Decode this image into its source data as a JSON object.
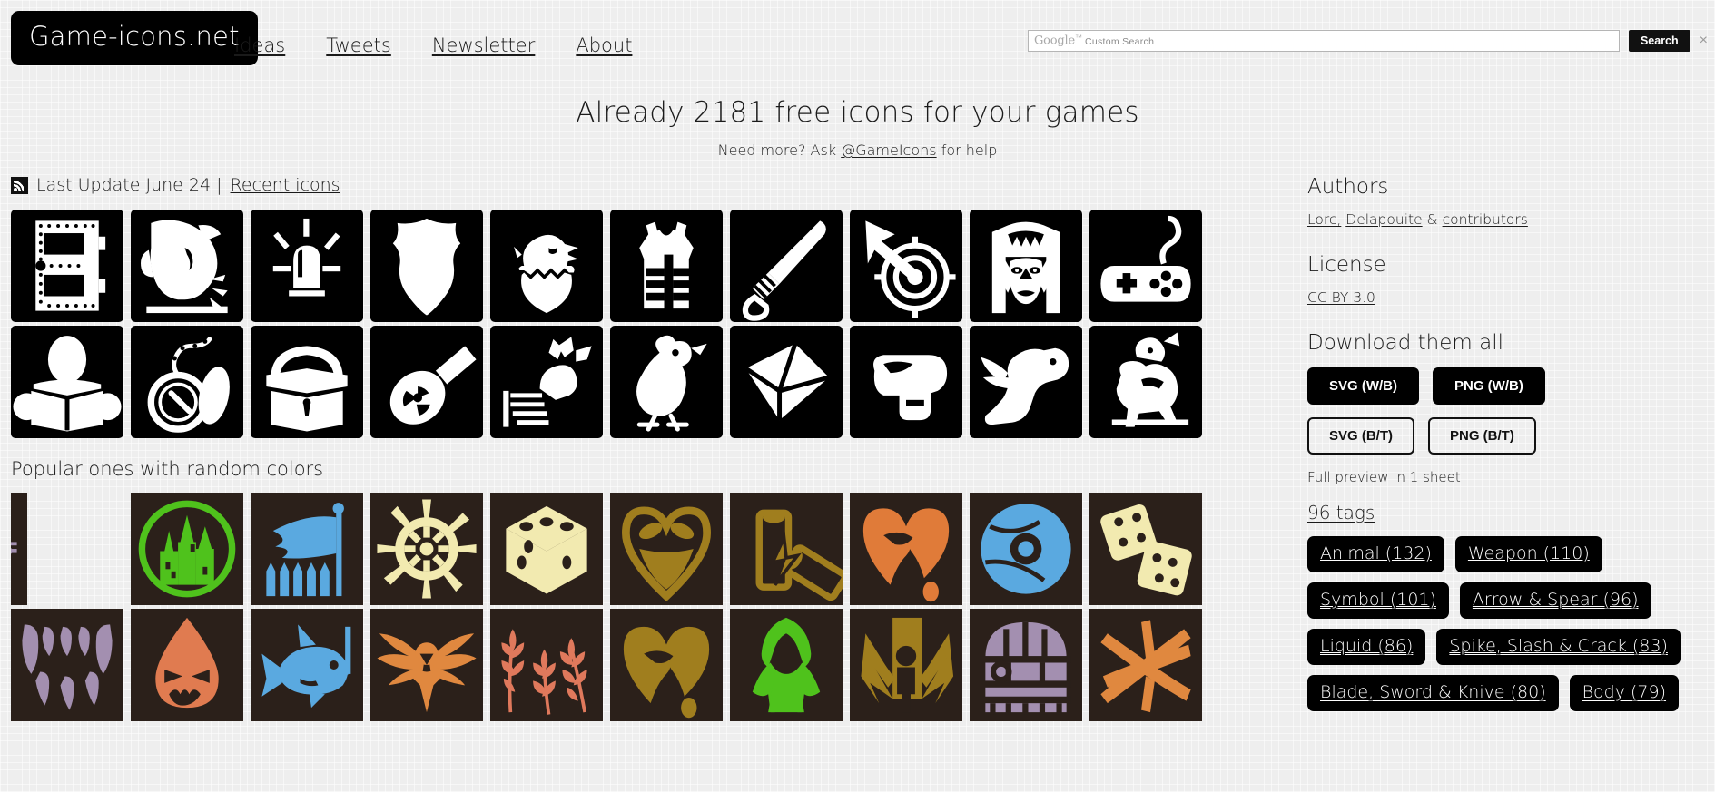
{
  "header": {
    "logo": "Game-icons.net",
    "nav": [
      {
        "label": "Ideas"
      },
      {
        "label": "Tweets"
      },
      {
        "label": "Newsletter"
      },
      {
        "label": "About"
      }
    ],
    "search": {
      "google_word": "Google",
      "tm": "™",
      "placeholder_suffix": "Custom Search",
      "value": "",
      "button_label": "Search",
      "close_icon": "×"
    }
  },
  "hero": {
    "title": "Already 2181 free icons for your games",
    "sub_prefix": "Need more? Ask ",
    "sub_link": "@GameIcons",
    "sub_suffix": " for help"
  },
  "update": {
    "icon": "rss-icon",
    "text": "Last Update June 24 |",
    "link": "Recent icons"
  },
  "sections": {
    "popular_title": "Popular ones with random colors"
  },
  "bw_icons": [
    {
      "name": "metal-door-icon"
    },
    {
      "name": "boar-snout-icon"
    },
    {
      "name": "siren-light-icon"
    },
    {
      "name": "police-badge-icon"
    },
    {
      "name": "hatching-chick-icon"
    },
    {
      "name": "bulletproof-vest-icon"
    },
    {
      "name": "baseball-bat-icon"
    },
    {
      "name": "arrow-on-target-icon"
    },
    {
      "name": "vampire-face-icon"
    },
    {
      "name": "gamepad-icon"
    },
    {
      "name": "reading-person-icon"
    },
    {
      "name": "pocket-watch-icon"
    },
    {
      "name": "treasure-chest-icon"
    },
    {
      "name": "nuclear-bomb-icon"
    },
    {
      "name": "bone-fist-icon"
    },
    {
      "name": "chicken-icon"
    },
    {
      "name": "folded-paper-icon"
    },
    {
      "name": "saddle-icon"
    },
    {
      "name": "pegasus-icon"
    },
    {
      "name": "knight-horse-icon"
    }
  ],
  "color_icons": [
    {
      "name": "clipped-tile-icon",
      "color": "#a38fb0",
      "clipped": true
    },
    {
      "name": "castle-icon",
      "color": "#4fc21c"
    },
    {
      "name": "flag-spears-icon",
      "color": "#5aa9e0"
    },
    {
      "name": "ship-wheel-icon",
      "color": "#f2eab0"
    },
    {
      "name": "dice-icon",
      "color": "#f2eab0"
    },
    {
      "name": "heart-bottle-icon",
      "color": "#a07e1e"
    },
    {
      "name": "batteries-icon",
      "color": "#a07e1e"
    },
    {
      "name": "bleeding-heart-icon",
      "color": "#e07b39"
    },
    {
      "name": "compact-disc-icon",
      "color": "#5aa9e0"
    },
    {
      "name": "dice-pair-icon",
      "color": "#f2eab0"
    },
    {
      "name": "fangs-icon",
      "color": "#a38fb0"
    },
    {
      "name": "evil-drop-icon",
      "color": "#e07b50"
    },
    {
      "name": "shark-hook-icon",
      "color": "#5aa9e0"
    },
    {
      "name": "wings-icon",
      "color": "#e0883f"
    },
    {
      "name": "wheat-icon",
      "color": "#e0795c"
    },
    {
      "name": "drained-heart-icon",
      "color": "#a07e1e"
    },
    {
      "name": "hooded-cloak-icon",
      "color": "#4fc21c"
    },
    {
      "name": "impaled-person-icon",
      "color": "#a07e1e"
    },
    {
      "name": "wooden-door-icon",
      "color": "#a38fb0"
    },
    {
      "name": "crossed-sticks-icon",
      "color": "#e0883f"
    }
  ],
  "sidebar": {
    "authors_title": "Authors",
    "authors": [
      {
        "label": "Lorc,"
      },
      {
        "label": "Delapouite"
      },
      {
        "label": "contributors"
      }
    ],
    "authors_sep": "&",
    "license_title": "License",
    "license_link": "CC BY 3.0",
    "download_title": "Download them all",
    "download_buttons": [
      {
        "label": "SVG (W/B)",
        "style": "filled"
      },
      {
        "label": "PNG (W/B)",
        "style": "filled"
      },
      {
        "label": "SVG (B/T)",
        "style": "outline"
      },
      {
        "label": "PNG (B/T)",
        "style": "outline"
      }
    ],
    "full_preview": "Full preview in 1 sheet",
    "tags_count": "96 tags",
    "tags": [
      {
        "label": "Animal (132)"
      },
      {
        "label": "Weapon (110)"
      },
      {
        "label": "Symbol (101)"
      },
      {
        "label": "Arrow & Spear (96)"
      },
      {
        "label": "Liquid (86)"
      },
      {
        "label": "Spike, Slash & Crack (83)"
      },
      {
        "label": "Blade, Sword & Knive (80)"
      },
      {
        "label": "Body (79)"
      }
    ]
  },
  "colors": {
    "page_bg": "#eeeeee",
    "tile_bw_bg": "#000000",
    "tile_color_bg": "#2b201a",
    "accent_black": "#000000"
  }
}
